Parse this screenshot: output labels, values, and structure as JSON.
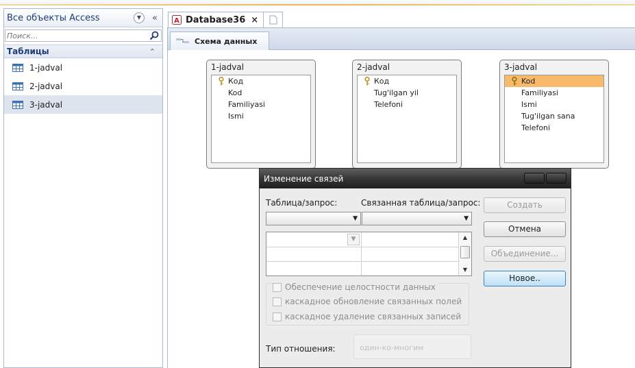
{
  "nav": {
    "title": "Все объекты Access",
    "search_placeholder": "Поиск...",
    "group_title": "Таблицы",
    "items": [
      {
        "label": "1-jadval"
      },
      {
        "label": "2-jadval"
      },
      {
        "label": "3-jadval"
      }
    ]
  },
  "doc_tab": {
    "label": "Database36",
    "close": "×"
  },
  "sub_tab": {
    "label": "Схема данных"
  },
  "tables": [
    {
      "title": "1-jadval",
      "fields": [
        "Код",
        "Kod",
        "Familiyasi",
        "Ismi"
      ]
    },
    {
      "title": "2-jadval",
      "fields": [
        "Код",
        "Tug'ilgan yil",
        "Telefoni"
      ]
    },
    {
      "title": "3-jadval",
      "fields": [
        "Kod",
        "Familiyasi",
        "Ismi",
        "Tug'ilgan sana",
        "Telefoni"
      ]
    }
  ],
  "dialog": {
    "title": "Изменение связей",
    "table_label": "Таблица/запрос:",
    "related_label": "Связанная таблица/запрос:",
    "ri_label": "Обеспечение целостности данных",
    "cascade_update": "каскадное обновление связанных полей",
    "cascade_delete": "каскадное удаление связанных записей",
    "reltype_label": "Тип отношения:",
    "reltype_value": "один-ко-многим",
    "buttons": {
      "create": "Создать",
      "cancel": "Отмена",
      "join": "Объединение...",
      "new": "Новое.."
    }
  },
  "colors": {
    "accent": "#1f3a78",
    "selected_field": "#f9b96a",
    "dialog_title": "#2b2b2b"
  }
}
